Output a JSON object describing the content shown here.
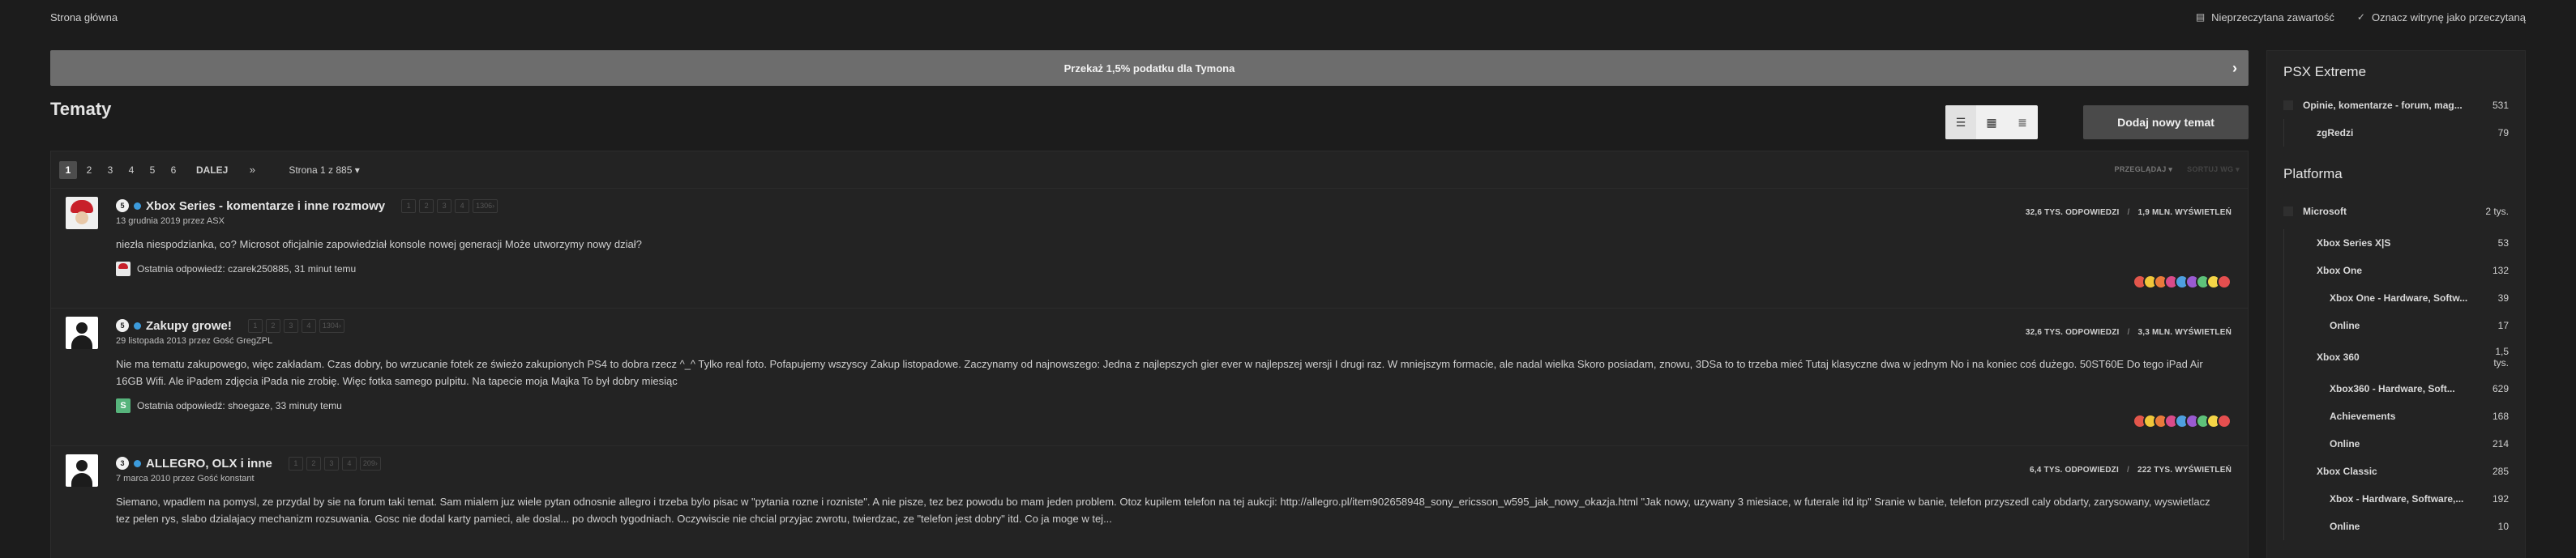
{
  "topbar": {
    "home": "Strona główna",
    "unread": "Nieprzeczytana zawartość",
    "mark_read": "Oznacz witrynę jako przeczytaną"
  },
  "banner": {
    "text": "Przekaż 1,5% podatku dla Tymona"
  },
  "page": {
    "title": "Tematy",
    "new_topic": "Dodaj nowy temat"
  },
  "pager": {
    "pages": [
      "1",
      "2",
      "3",
      "4",
      "5",
      "6"
    ],
    "next": "DALEJ",
    "last": "»",
    "page_of": "Strona 1 z 885",
    "sort_1": "PRZEGLĄDAJ",
    "sort_2": "SORTUJ WG"
  },
  "topics": [
    {
      "num": "5",
      "title": "Xbox Series - komentarze i inne rozmowy",
      "pages": [
        "1",
        "2",
        "3",
        "4",
        "1306"
      ],
      "meta": "13 grudnia 2019 przez ASX",
      "replies": "32,6 TYS. ODPOWIEDZI",
      "views": "1,9 MLN. WYŚWIETLEŃ",
      "snippet": "niezła niespodzianka, co? Microsot oficjalnie zapowiedział konsole nowej generacji Może utworzymy nowy dział?",
      "last": "Ostatnia odpowiedź: czarek250885, 31 minut temu",
      "last_avatar": ""
    },
    {
      "num": "5",
      "title": "Zakupy growe!",
      "pages": [
        "1",
        "2",
        "3",
        "4",
        "1304"
      ],
      "meta": "29 listopada 2013 przez Gość GregZPL",
      "replies": "32,6 TYS. ODPOWIEDZI",
      "views": "3,3 MLN. WYŚWIETLEŃ",
      "snippet": "Nie ma tematu zakupowego, więc zakładam. Czas dobry, bo wrzucanie fotek ze świeżo zakupionych PS4 to dobra rzecz ^_^ Tylko real foto. Pofapujemy wszyscy Zakup listopadowe. Zaczynamy od najnowszego: Jedna z najlepszych gier ever w najlepszej wersji I drugi raz. W mniejszym formacie, ale nadal wielka Skoro posiadam, znowu, 3DSa to to trzeba mieć Tutaj klasyczne dwa w jednym No i na koniec coś dużego. 50ST60E Do tego iPad Air 16GB Wifi. Ale iPadem zdjęcia iPada nie zrobię. Więc fotka samego pulpitu. Na tapecie moja Majka To był dobry miesiąc",
      "last": "Ostatnia odpowiedź: shoegaze, 33 minuty temu",
      "last_avatar": "S"
    },
    {
      "num": "3",
      "title": "ALLEGRO, OLX i inne",
      "pages": [
        "1",
        "2",
        "3",
        "4",
        "209"
      ],
      "meta": "7 marca 2010 przez Gość konstant",
      "replies": "6,4 TYS. ODPOWIEDZI",
      "views": "222 TYS. WYŚWIETLEŃ",
      "snippet": "Siemano, wpadlem na pomysl, ze przydal by sie na forum taki temat. Sam mialem juz wiele pytan odnosnie allegro i trzeba bylo pisac w \"pytania rozne i rozniste\". A nie pisze, tez bez powodu bo mam jeden problem. Otoz kupilem telefon na tej aukcji: http://allegro.pl/item902658948_sony_ericsson_w595_jak_nowy_okazja.html \"Jak nowy, uzywany 3 miesiace, w futerale itd itp\" Sranie w banie, telefon przyszedl caly obdarty, zarysowany, wyswietlacz tez pelen rys, slabo dzialajacy mechanizm rozsuwania. Gosc nie dodal karty pamieci, ale doslal... po dwoch tygodniach. Oczywiscie nie chcial przyjac zwrotu, twierdzac, ze \"telefon jest dobry\" itd. Co ja moge w tej...",
      "last": "",
      "last_avatar": ""
    }
  ],
  "reaction_colors": [
    "#e2564b",
    "#f0c63a",
    "#e97a3b",
    "#d94b8a",
    "#4ea0e0",
    "#9a5bd1",
    "#5ec27a",
    "#f5d547",
    "#e54f4f"
  ],
  "sidebar": {
    "sections": [
      {
        "title": "PSX Extreme",
        "items": [
          {
            "label": "Opinie, komentarze - forum, mag...",
            "count": "531",
            "level": 0
          },
          {
            "label": "zgRedzi",
            "count": "79",
            "level": 1
          }
        ]
      },
      {
        "title": "Platforma",
        "items": [
          {
            "label": "Microsoft",
            "count": "2 tys.",
            "level": 0
          },
          {
            "label": "Xbox Series X|S",
            "count": "53",
            "level": 1
          },
          {
            "label": "Xbox One",
            "count": "132",
            "level": 1
          },
          {
            "label": "Xbox One - Hardware, Softw...",
            "count": "39",
            "level": 2
          },
          {
            "label": "Online",
            "count": "17",
            "level": 2
          },
          {
            "label": "Xbox 360",
            "count": "1,5 tys.",
            "level": 1
          },
          {
            "label": "Xbox360 - Hardware, Soft...",
            "count": "629",
            "level": 2
          },
          {
            "label": "Achievements",
            "count": "168",
            "level": 2
          },
          {
            "label": "Online",
            "count": "214",
            "level": 2
          },
          {
            "label": "Xbox Classic",
            "count": "285",
            "level": 1
          },
          {
            "label": "Xbox - Hardware, Software,...",
            "count": "192",
            "level": 2
          },
          {
            "label": "Online",
            "count": "10",
            "level": 2
          }
        ]
      }
    ]
  }
}
